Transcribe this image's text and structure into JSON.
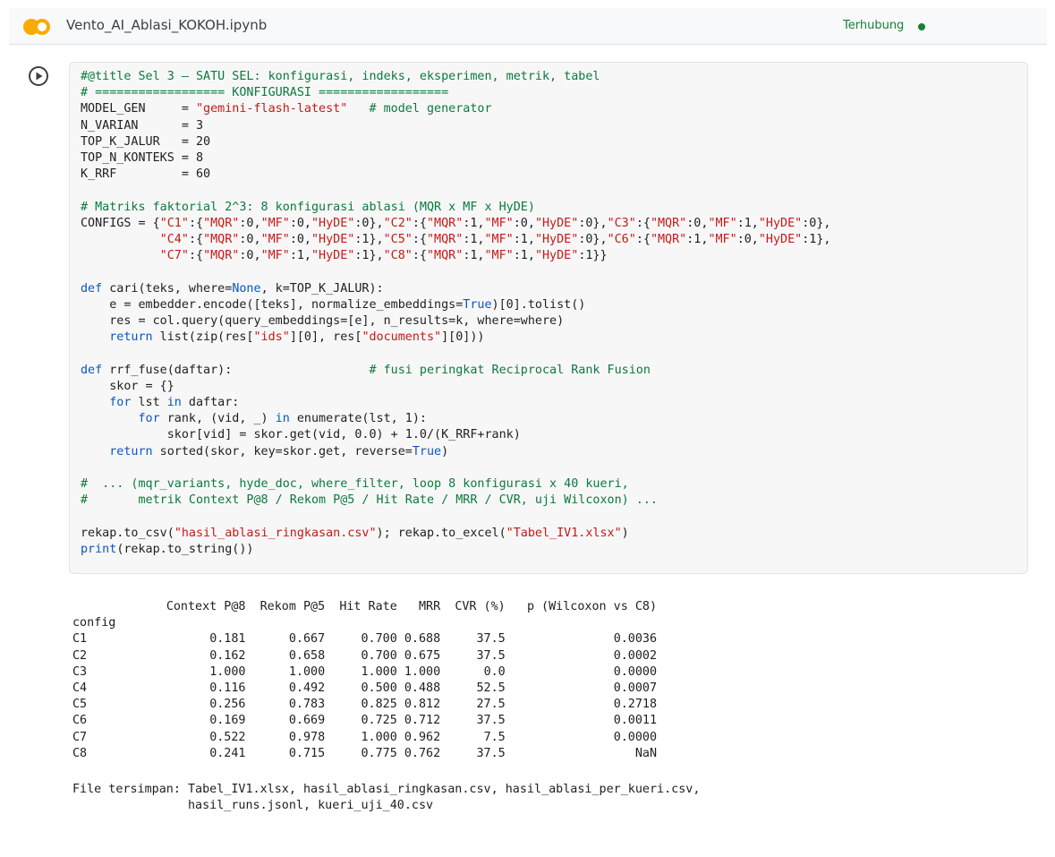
{
  "header": {
    "notebook_title": "Vento_AI_Ablasi_KOKOH.ipynb",
    "status": "Terhubung",
    "logo_icon": "colab-logo",
    "status_color": "#188038"
  },
  "cell": {
    "run_icon": "play-circle-icon",
    "code_lines": [
      [
        {
          "t": "#@title Sel 3 — SATU SEL: konfigurasi, indeks, eksperimen, metrik, tabel",
          "c": "cm"
        }
      ],
      [
        {
          "t": "# ================== KONFIGURASI ==================",
          "c": "cm"
        }
      ],
      [
        {
          "t": "MODEL_GEN     = "
        },
        {
          "t": "\"gemini-flash-latest\"",
          "c": "st"
        },
        {
          "t": "   "
        },
        {
          "t": "# model generator",
          "c": "cm"
        }
      ],
      [
        {
          "t": "N_VARIAN      = 3"
        }
      ],
      [
        {
          "t": "TOP_K_JALUR   = 20"
        }
      ],
      [
        {
          "t": "TOP_N_KONTEKS = 8"
        }
      ],
      [
        {
          "t": "K_RRF         = 60"
        }
      ],
      [],
      [
        {
          "t": "# Matriks faktorial 2^3: 8 konfigurasi ablasi (MQR x MF x HyDE)",
          "c": "cm"
        }
      ],
      [
        {
          "t": "CONFIGS = {"
        },
        {
          "t": "\"C1\"",
          "c": "st"
        },
        {
          "t": ":{"
        },
        {
          "t": "\"MQR\"",
          "c": "st"
        },
        {
          "t": ":0,"
        },
        {
          "t": "\"MF\"",
          "c": "st"
        },
        {
          "t": ":0,"
        },
        {
          "t": "\"HyDE\"",
          "c": "st"
        },
        {
          "t": ":0},"
        },
        {
          "t": "\"C2\"",
          "c": "st"
        },
        {
          "t": ":{"
        },
        {
          "t": "\"MQR\"",
          "c": "st"
        },
        {
          "t": ":1,"
        },
        {
          "t": "\"MF\"",
          "c": "st"
        },
        {
          "t": ":0,"
        },
        {
          "t": "\"HyDE\"",
          "c": "st"
        },
        {
          "t": ":0},"
        },
        {
          "t": "\"C3\"",
          "c": "st"
        },
        {
          "t": ":{"
        },
        {
          "t": "\"MQR\"",
          "c": "st"
        },
        {
          "t": ":0,"
        },
        {
          "t": "\"MF\"",
          "c": "st"
        },
        {
          "t": ":1,"
        },
        {
          "t": "\"HyDE\"",
          "c": "st"
        },
        {
          "t": ":0},"
        }
      ],
      [
        {
          "t": "           "
        },
        {
          "t": "\"C4\"",
          "c": "st"
        },
        {
          "t": ":{"
        },
        {
          "t": "\"MQR\"",
          "c": "st"
        },
        {
          "t": ":0,"
        },
        {
          "t": "\"MF\"",
          "c": "st"
        },
        {
          "t": ":0,"
        },
        {
          "t": "\"HyDE\"",
          "c": "st"
        },
        {
          "t": ":1},"
        },
        {
          "t": "\"C5\"",
          "c": "st"
        },
        {
          "t": ":{"
        },
        {
          "t": "\"MQR\"",
          "c": "st"
        },
        {
          "t": ":1,"
        },
        {
          "t": "\"MF\"",
          "c": "st"
        },
        {
          "t": ":1,"
        },
        {
          "t": "\"HyDE\"",
          "c": "st"
        },
        {
          "t": ":0},"
        },
        {
          "t": "\"C6\"",
          "c": "st"
        },
        {
          "t": ":{"
        },
        {
          "t": "\"MQR\"",
          "c": "st"
        },
        {
          "t": ":1,"
        },
        {
          "t": "\"MF\"",
          "c": "st"
        },
        {
          "t": ":0,"
        },
        {
          "t": "\"HyDE\"",
          "c": "st"
        },
        {
          "t": ":1},"
        }
      ],
      [
        {
          "t": "           "
        },
        {
          "t": "\"C7\"",
          "c": "st"
        },
        {
          "t": ":{"
        },
        {
          "t": "\"MQR\"",
          "c": "st"
        },
        {
          "t": ":0,"
        },
        {
          "t": "\"MF\"",
          "c": "st"
        },
        {
          "t": ":1,"
        },
        {
          "t": "\"HyDE\"",
          "c": "st"
        },
        {
          "t": ":1},"
        },
        {
          "t": "\"C8\"",
          "c": "st"
        },
        {
          "t": ":{"
        },
        {
          "t": "\"MQR\"",
          "c": "st"
        },
        {
          "t": ":1,"
        },
        {
          "t": "\"MF\"",
          "c": "st"
        },
        {
          "t": ":1,"
        },
        {
          "t": "\"HyDE\"",
          "c": "st"
        },
        {
          "t": ":1}}"
        }
      ],
      [],
      [
        {
          "t": "def",
          "c": "kw"
        },
        {
          "t": " cari(teks, where="
        },
        {
          "t": "None",
          "c": "kw"
        },
        {
          "t": ", k=TOP_K_JALUR):"
        }
      ],
      [
        {
          "t": "    e = embedder.encode([teks], normalize_embeddings="
        },
        {
          "t": "True",
          "c": "kw"
        },
        {
          "t": ")[0].tolist()"
        }
      ],
      [
        {
          "t": "    res = col.query(query_embeddings=[e], n_results=k, where=where)"
        }
      ],
      [
        {
          "t": "    "
        },
        {
          "t": "return",
          "c": "kw"
        },
        {
          "t": " list(zip(res["
        },
        {
          "t": "\"ids\"",
          "c": "st"
        },
        {
          "t": "][0], res["
        },
        {
          "t": "\"documents\"",
          "c": "st"
        },
        {
          "t": "][0]))"
        }
      ],
      [],
      [
        {
          "t": "def",
          "c": "kw"
        },
        {
          "t": " rrf_fuse(daftar):                   "
        },
        {
          "t": "# fusi peringkat Reciprocal Rank Fusion",
          "c": "cm"
        }
      ],
      [
        {
          "t": "    skor = {}"
        }
      ],
      [
        {
          "t": "    "
        },
        {
          "t": "for",
          "c": "kw"
        },
        {
          "t": " lst "
        },
        {
          "t": "in",
          "c": "kw"
        },
        {
          "t": " daftar:"
        }
      ],
      [
        {
          "t": "        "
        },
        {
          "t": "for",
          "c": "kw"
        },
        {
          "t": " rank, (vid, _) "
        },
        {
          "t": "in",
          "c": "kw"
        },
        {
          "t": " enumerate(lst, 1):"
        }
      ],
      [
        {
          "t": "            skor[vid] = skor.get(vid, 0.0) + 1.0/(K_RRF+rank)"
        }
      ],
      [
        {
          "t": "    "
        },
        {
          "t": "return",
          "c": "kw"
        },
        {
          "t": " sorted(skor, key=skor.get, reverse="
        },
        {
          "t": "True",
          "c": "kw"
        },
        {
          "t": ")"
        }
      ],
      [],
      [
        {
          "t": "#  ... (mqr_variants, hyde_doc, where_filter, loop 8 konfigurasi x 40 kueri,",
          "c": "cm"
        }
      ],
      [
        {
          "t": "#       metrik Context P@8 / Rekom P@5 / Hit Rate / MRR / CVR, uji Wilcoxon) ...",
          "c": "cm"
        }
      ],
      [],
      [
        {
          "t": "rekap.to_csv("
        },
        {
          "t": "\"hasil_ablasi_ringkasan.csv\"",
          "c": "st"
        },
        {
          "t": "); rekap.to_excel("
        },
        {
          "t": "\"Tabel_IV1.xlsx\"",
          "c": "st"
        },
        {
          "t": ")"
        }
      ],
      [
        {
          "t": "print",
          "c": "kw"
        },
        {
          "t": "(rekap.to_string())"
        }
      ]
    ]
  },
  "output": {
    "columns": [
      "Context P@8",
      "Rekom P@5",
      "Hit Rate",
      "MRR",
      "CVR (%)",
      "p (Wilcoxon vs C8)"
    ],
    "index_name": "config",
    "rows": [
      {
        "config": "C1",
        "values": [
          "0.181",
          "0.667",
          "0.700",
          "0.688",
          "37.5",
          "0.0036"
        ]
      },
      {
        "config": "C2",
        "values": [
          "0.162",
          "0.658",
          "0.700",
          "0.675",
          "37.5",
          "0.0002"
        ]
      },
      {
        "config": "C3",
        "values": [
          "1.000",
          "1.000",
          "1.000",
          "1.000",
          "0.0",
          "0.0000"
        ]
      },
      {
        "config": "C4",
        "values": [
          "0.116",
          "0.492",
          "0.500",
          "0.488",
          "52.5",
          "0.0007"
        ]
      },
      {
        "config": "C5",
        "values": [
          "0.256",
          "0.783",
          "0.825",
          "0.812",
          "27.5",
          "0.2718"
        ]
      },
      {
        "config": "C6",
        "values": [
          "0.169",
          "0.669",
          "0.725",
          "0.712",
          "37.5",
          "0.0011"
        ]
      },
      {
        "config": "C7",
        "values": [
          "0.522",
          "0.978",
          "1.000",
          "0.962",
          "7.5",
          "0.0000"
        ]
      },
      {
        "config": "C8",
        "values": [
          "0.241",
          "0.715",
          "0.775",
          "0.762",
          "37.5",
          "NaN"
        ]
      }
    ],
    "files_line_1": "File tersimpan: Tabel_IV1.xlsx, hasil_ablasi_ringkasan.csv, hasil_ablasi_per_kueri.csv,",
    "files_line_2": "                hasil_runs.jsonl, kueri_uji_40.csv"
  }
}
